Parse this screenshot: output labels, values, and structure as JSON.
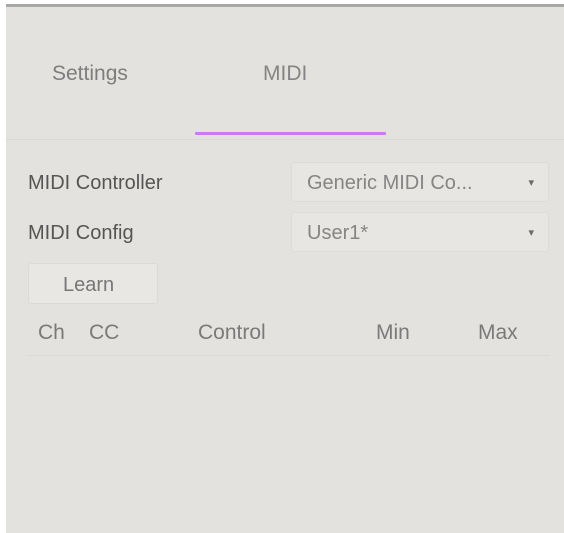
{
  "tabs": {
    "settings": "Settings",
    "midi": "MIDI",
    "active": "MIDI",
    "accent_color": "#c87cf2"
  },
  "midi_controller": {
    "label": "MIDI Controller",
    "value": "Generic MIDI Co...",
    "caret": "▾"
  },
  "midi_config": {
    "label": "MIDI Config",
    "value": "User1*",
    "caret": "▾"
  },
  "learn_button": {
    "label": "Learn"
  },
  "table": {
    "columns": [
      "Ch",
      "CC",
      "Control",
      "Min",
      "Max"
    ],
    "rows": []
  }
}
